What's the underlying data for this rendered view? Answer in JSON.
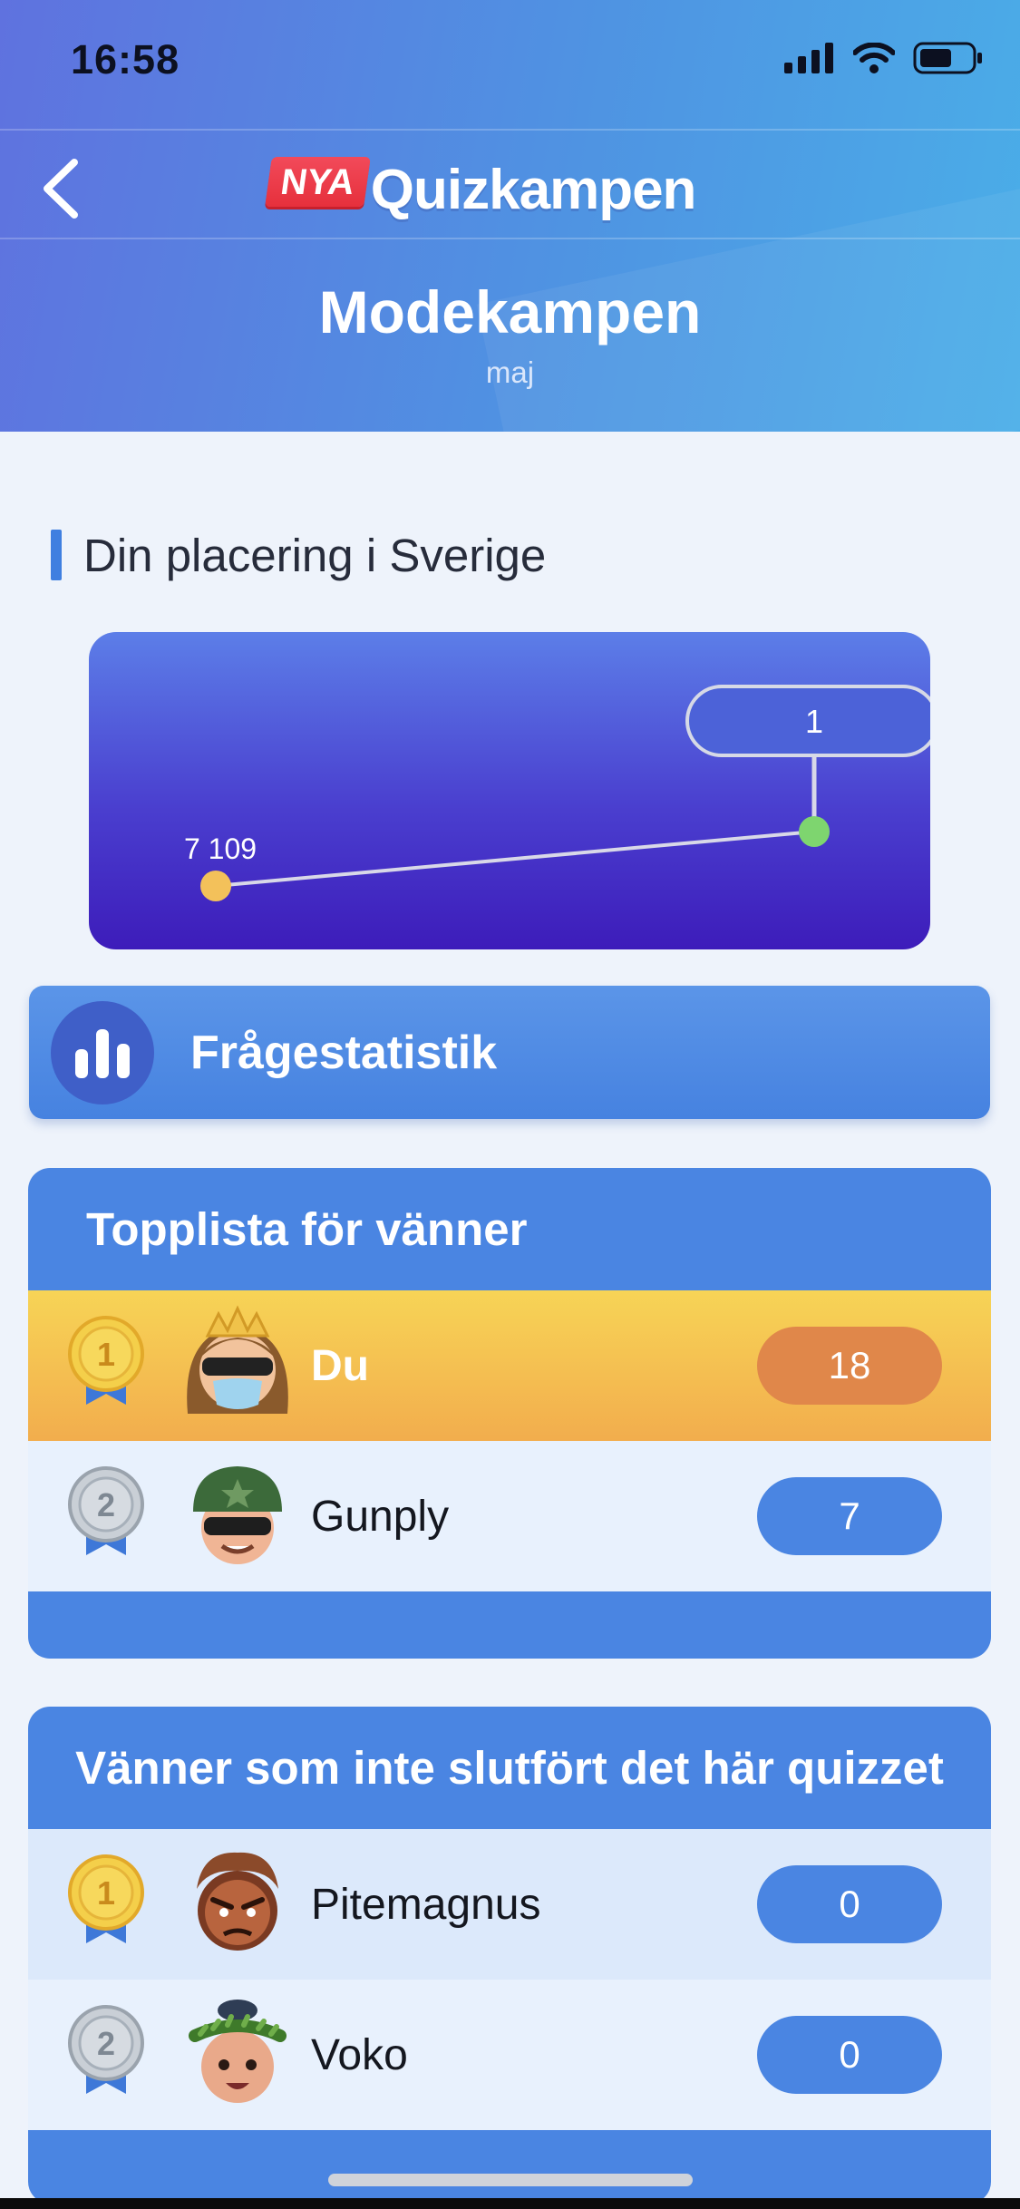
{
  "status_bar": {
    "time": "16:58"
  },
  "header": {
    "logo_badge": "NYA",
    "logo_text": "Quizkampen",
    "title": "Modekampen",
    "subtitle": "maj"
  },
  "placement": {
    "section_title": "Din placering i Sverige",
    "chart_data": {
      "type": "line",
      "series": [
        {
          "values": [
            7109,
            1
          ]
        }
      ],
      "data_labels": [
        "7 109",
        "1"
      ],
      "colors": {
        "start_point": "#f3c15a",
        "end_point": "#7ed56f",
        "line": "#d8d8e8"
      }
    }
  },
  "question_stats": {
    "label": "Frågestatistik",
    "icon": "bar-chart-icon"
  },
  "friends_leaderboard": {
    "title": "Topplista för vänner",
    "rows": [
      {
        "rank": "1",
        "name": "Du",
        "score": "18",
        "medal": "gold",
        "avatar": "queen-avatar-icon"
      },
      {
        "rank": "2",
        "name": "Gunply",
        "score": "7",
        "medal": "silver",
        "avatar": "soldier-avatar-icon"
      }
    ]
  },
  "unfinished_friends": {
    "title": "Vänner som inte slutfört det här quizzet",
    "rows": [
      {
        "rank": "1",
        "name": "Pitemagnus",
        "score": "0",
        "medal": "gold",
        "avatar": "angry-avatar-icon"
      },
      {
        "rank": "2",
        "name": "Voko",
        "score": "0",
        "medal": "silver",
        "avatar": "wreath-avatar-icon"
      }
    ]
  }
}
